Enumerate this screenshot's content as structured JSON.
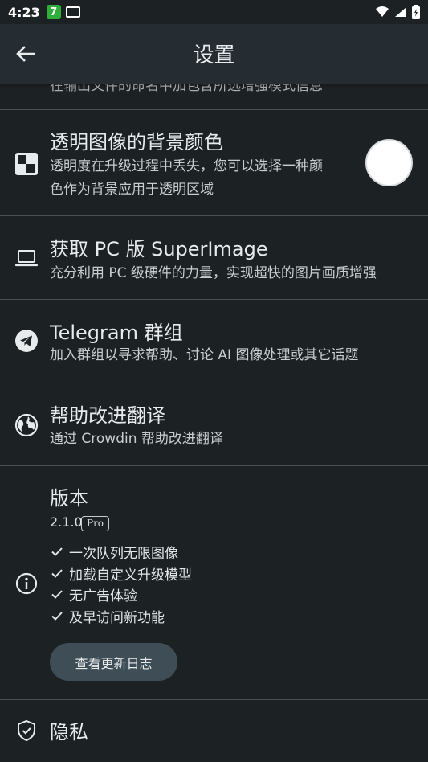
{
  "status_bar": {
    "time": "4:23",
    "badge": "7"
  },
  "app_bar": {
    "title": "设置"
  },
  "partial_item": {
    "text": "在输出文件的命名中加包含所选增强模式信息"
  },
  "settings": {
    "transparent_bg": {
      "title": "透明图像的背景颜色",
      "line1": "透明度在升级过程中丢失，您可以选择一种颜",
      "line2": "色作为背景应用于透明区域",
      "swatch_color": "#ffffff"
    },
    "pc_version": {
      "title": "获取 PC 版 SuperImage",
      "subtitle": "充分利用 PC 级硬件的力量，实现超快的图片画质增强"
    },
    "telegram": {
      "title": "Telegram 群组",
      "subtitle": "加入群组以寻求帮助、讨论 AI 图像处理或其它话题"
    },
    "translate": {
      "title": "帮助改进翻译",
      "subtitle": "通过 Crowdin 帮助改进翻译"
    },
    "version": {
      "title": "版本",
      "number": "2.1.0",
      "badge": "Pro",
      "features": [
        "一次队列无限图像",
        "加载自定义升级模型",
        "无广告体验",
        "及早访问新功能"
      ],
      "changelog_label": "查看更新日志"
    },
    "privacy": {
      "title": "隐私"
    }
  },
  "icons": {
    "back": "arrow-left-icon",
    "transparent_bg": "checkerboard-icon",
    "pc_version": "laptop-icon",
    "telegram": "telegram-icon",
    "translate": "globe-icon",
    "version": "info-icon",
    "privacy": "shield-check-icon"
  },
  "colors": {
    "background": "#1c2124",
    "app_bar": "#262d32",
    "button": "#3e4d56",
    "status_badge": "#2fae3b"
  }
}
